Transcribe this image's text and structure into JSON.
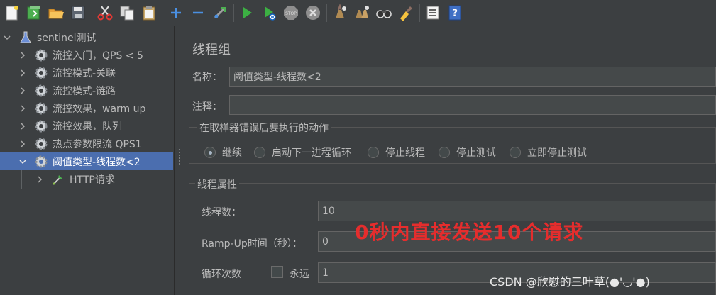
{
  "toolbar": {
    "buttons": [
      {
        "name": "new-icon"
      },
      {
        "name": "templates-icon"
      },
      {
        "name": "open-icon"
      },
      {
        "name": "save-icon"
      },
      {
        "name": "cut-icon"
      },
      {
        "name": "copy-icon"
      },
      {
        "name": "paste-icon"
      },
      {
        "name": "expand-icon"
      },
      {
        "name": "collapse-icon"
      },
      {
        "name": "toggle-icon"
      },
      {
        "name": "start-icon"
      },
      {
        "name": "start-no-pauses-icon"
      },
      {
        "name": "stop-icon"
      },
      {
        "name": "shutdown-icon"
      },
      {
        "name": "clear-icon"
      },
      {
        "name": "clear-all-icon"
      },
      {
        "name": "search-icon"
      },
      {
        "name": "reset-search-icon"
      },
      {
        "name": "function-helper-icon"
      },
      {
        "name": "help-icon"
      }
    ]
  },
  "tree": {
    "root_label": "sentinel测试",
    "items": [
      {
        "label": "流控入门，QPS < 5"
      },
      {
        "label": "流控模式-关联"
      },
      {
        "label": "流控模式-链路"
      },
      {
        "label": "流控效果，warm up"
      },
      {
        "label": "流控效果，队列"
      },
      {
        "label": "热点参数限流 QPS1"
      },
      {
        "label": "阈值类型-线程数<2"
      }
    ],
    "child_label": "HTTP请求"
  },
  "form": {
    "title": "线程组",
    "name_label": "名称：",
    "name_value": "阈值类型-线程数<2",
    "comment_label": "注释：",
    "comment_value": "",
    "error_action_title": "在取样器错误后要执行的动作",
    "error_actions": [
      {
        "label": "继续",
        "selected": true
      },
      {
        "label": "启动下一进程循环",
        "selected": false
      },
      {
        "label": "停止线程",
        "selected": false
      },
      {
        "label": "停止测试",
        "selected": false
      },
      {
        "label": "立即停止测试",
        "selected": false
      }
    ],
    "thread_props_title": "线程属性",
    "threads_label": "线程数：",
    "threads_value": "10",
    "rampup_label": "Ramp-Up时间（秒）：",
    "rampup_value": "0",
    "loop_label": "循环次数",
    "forever_label": "永远",
    "forever_checked": false,
    "loop_value": "1"
  },
  "annotation": "0秒内直接发送10个请求",
  "watermark": "CSDN @欣慰的三叶草(●'◡'●)",
  "colors": {
    "background": "#3c3f41",
    "selection": "#4b6eaf",
    "field_bg": "#45494a",
    "annotation_red": "#e52d2d"
  }
}
